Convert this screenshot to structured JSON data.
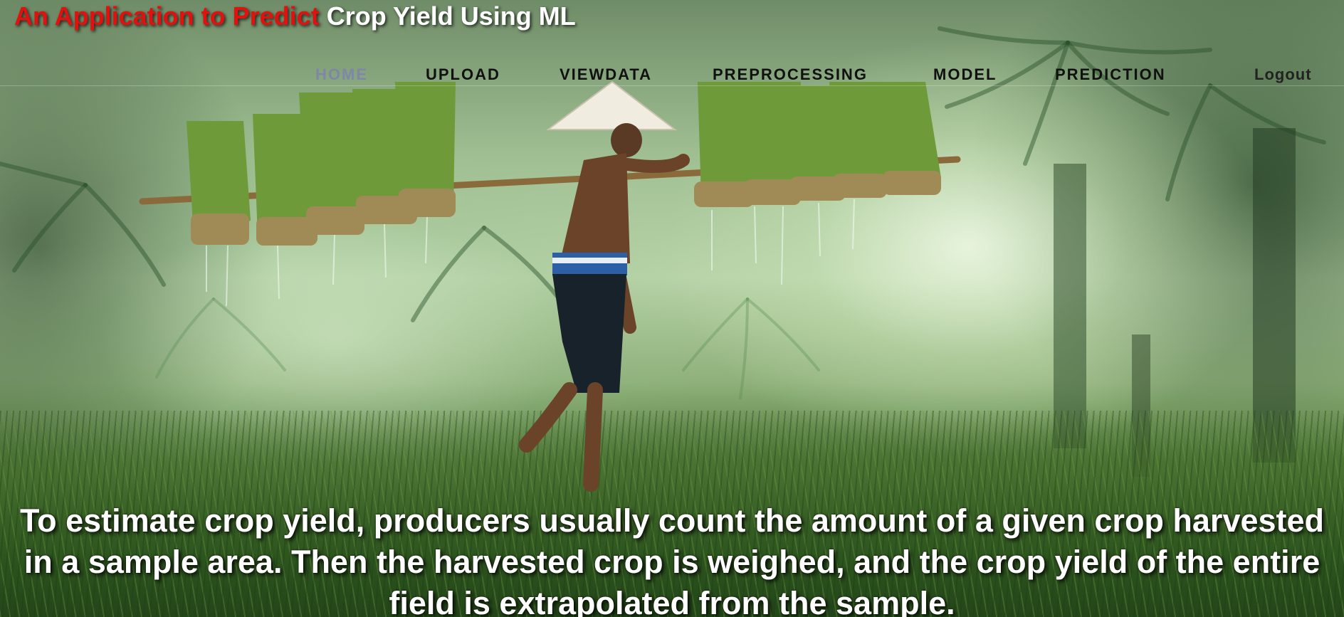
{
  "header": {
    "title_accent": "An Application to Predict",
    "title_main": "Crop Yield Using ML"
  },
  "nav": {
    "items": [
      {
        "label": "HOME",
        "active": true
      },
      {
        "label": "UPLOAD"
      },
      {
        "label": "VIEWDATA"
      },
      {
        "label": "PREPROCESSING"
      },
      {
        "label": "MODEL"
      },
      {
        "label": "PREDICTION"
      }
    ],
    "logout_label": "Logout"
  },
  "hero": {
    "caption": "To estimate crop yield, producers usually count the amount of a given crop harvested in a sample area. Then the harvested crop is weighed, and the crop yield of the entire field is extrapolated from the sample."
  },
  "colors": {
    "title_accent": "#e0120f",
    "title_main": "#ffffff",
    "nav_text": "#111111",
    "nav_active": "#7f86a8"
  }
}
